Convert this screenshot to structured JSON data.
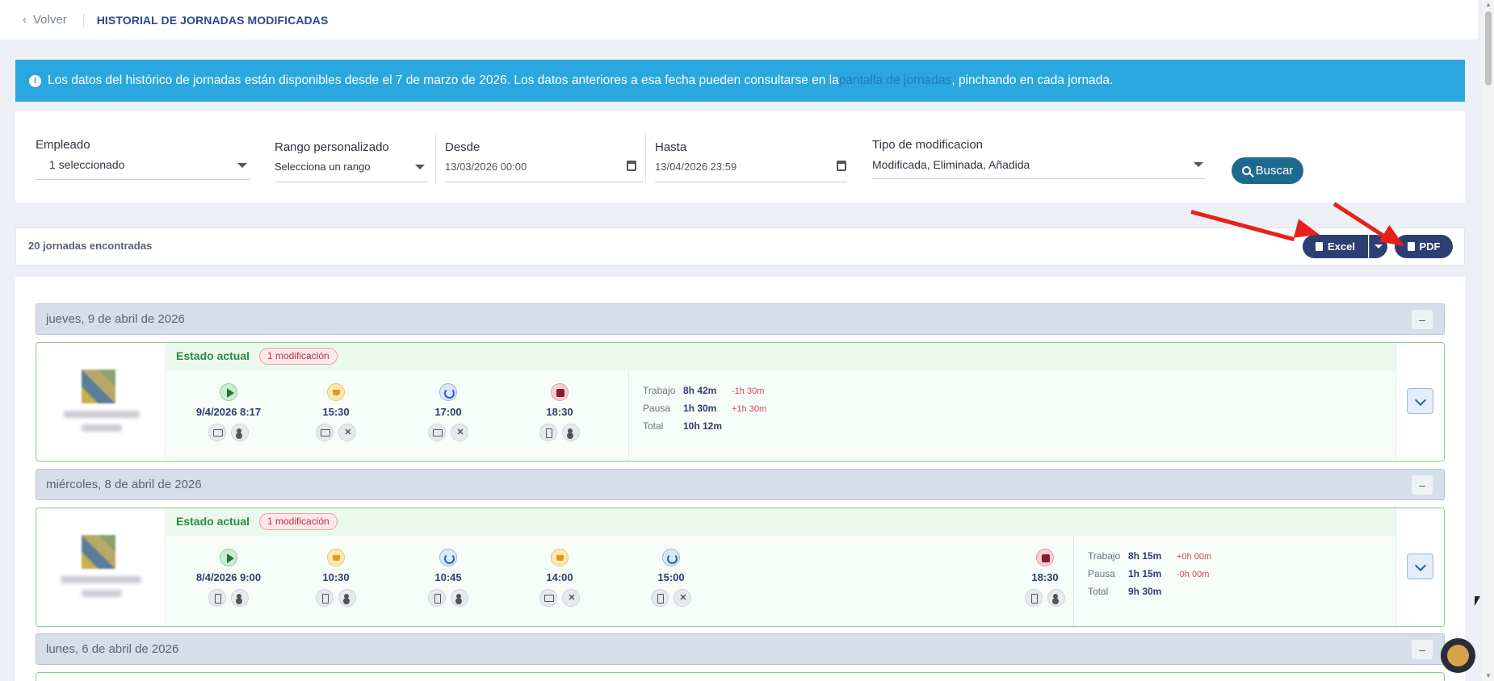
{
  "header": {
    "back_label": "Volver",
    "title": "HISTORIAL DE JORNADAS MODIFICADAS"
  },
  "info": {
    "text_before": "Los datos del histórico de jornadas están disponibles desde el 7 de marzo de 2026. Los datos anteriores a esa fecha pueden consultarse en la ",
    "link": "pantalla de jornadas",
    "text_after": ", pinchando en cada jornada."
  },
  "filters": {
    "empleado": {
      "label": "Empleado",
      "value": "1 seleccionado"
    },
    "rango": {
      "label": "Rango personalizado",
      "value": "Selecciona un rango"
    },
    "desde": {
      "label": "Desde",
      "value": "13/03/2026 00:00"
    },
    "hasta": {
      "label": "Hasta",
      "value": "13/04/2026 23:59"
    },
    "tipo": {
      "label": "Tipo de modificacion",
      "value": "Modificada, Eliminada, Añadida"
    },
    "search_label": "Buscar"
  },
  "results": {
    "count_label": "20 jornadas encontradas",
    "excel_label": "Excel",
    "pdf_label": "PDF"
  },
  "days": [
    {
      "date": "jueves, 9 de abril de 2026",
      "estado": "Estado actual",
      "badge": "1 modificación",
      "events": [
        {
          "type": "start",
          "time": "9/4/2026 8:17",
          "icons": [
            "desktop",
            "user"
          ]
        },
        {
          "type": "pause",
          "time": "15:30",
          "icons": [
            "desktop",
            "tools"
          ]
        },
        {
          "type": "resume",
          "time": "17:00",
          "icons": [
            "desktop",
            "tools"
          ]
        },
        {
          "type": "stop",
          "time": "18:30",
          "icons": [
            "phone",
            "user"
          ]
        }
      ],
      "totals": {
        "trabajo_label": "Trabajo",
        "trabajo": "8h 42m",
        "trabajo_diff": "-1h 30m",
        "pausa_label": "Pausa",
        "pausa": "1h 30m",
        "pausa_diff": "+1h 30m",
        "total_label": "Total",
        "total": "10h 12m"
      }
    },
    {
      "date": "miércoles, 8 de abril de 2026",
      "estado": "Estado actual",
      "badge": "1 modificación",
      "events": [
        {
          "type": "start",
          "time": "8/4/2026 9:00",
          "icons": [
            "phone",
            "user"
          ]
        },
        {
          "type": "pause",
          "time": "10:30",
          "icons": [
            "phone",
            "user"
          ]
        },
        {
          "type": "resume",
          "time": "10:45",
          "icons": [
            "phone",
            "user"
          ]
        },
        {
          "type": "pause",
          "time": "14:00",
          "icons": [
            "desktop",
            "tools"
          ]
        },
        {
          "type": "resume",
          "time": "15:00",
          "icons": [
            "phone",
            "tools"
          ]
        },
        {
          "type": "stop",
          "time": "18:30",
          "icons": [
            "phone",
            "user"
          ]
        }
      ],
      "totals": {
        "trabajo_label": "Trabajo",
        "trabajo": "8h 15m",
        "trabajo_diff": "+0h 00m",
        "pausa_label": "Pausa",
        "pausa": "1h 15m",
        "pausa_diff": "-0h 00m",
        "total_label": "Total",
        "total": "9h 30m"
      }
    },
    {
      "date": "lunes, 6 de abril de 2026"
    }
  ],
  "colors": {
    "accent": "#2d3e72",
    "info": "#2aa7de",
    "search": "#1e6a8c",
    "annotation_arrow": "#e8201a"
  }
}
